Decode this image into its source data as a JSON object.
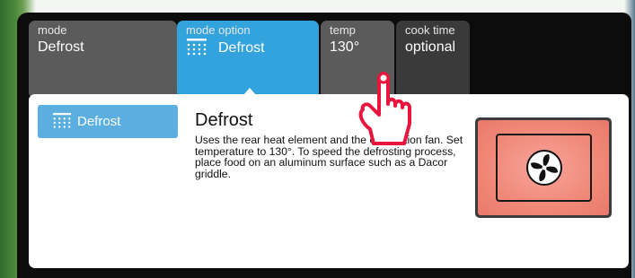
{
  "tabs": {
    "mode": {
      "label": "mode",
      "value": "Defrost"
    },
    "mode_option": {
      "label": "mode option",
      "value": "Defrost",
      "icon": "defrost-icon"
    },
    "temp": {
      "label": "temp",
      "value": "130°"
    },
    "cook_time": {
      "label": "cook time",
      "value": "optional"
    }
  },
  "panel": {
    "chip_label": "Defrost",
    "chip_icon": "defrost-icon",
    "title": "Defrost",
    "description": "Uses the rear heat element and the convection fan. Set temperature to 130°. To speed the defrosting process, place food on an aluminum surface such as a Dacor griddle.",
    "action_icon": "convection-fan-icon"
  },
  "colors": {
    "frame": "#0c0c0c",
    "tab_inactive": "#5b5b5b",
    "tab_active": "#33a3dd",
    "chip": "#5aaee0",
    "action": "#f08878"
  },
  "pointer_icon": "tap-hand-icon"
}
